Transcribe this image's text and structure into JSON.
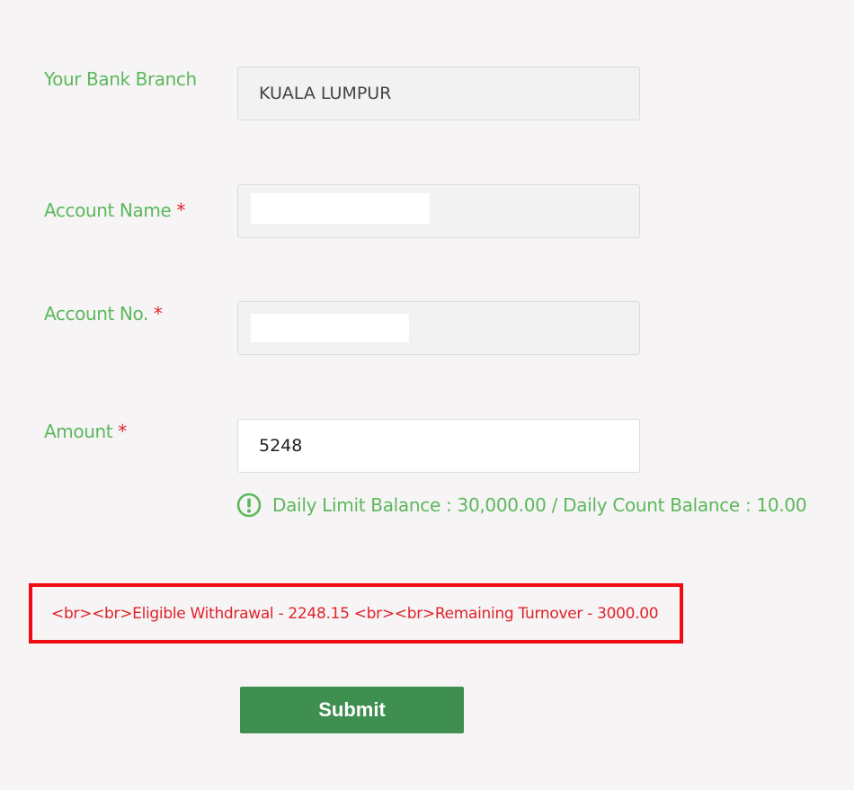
{
  "form": {
    "bank_branch": {
      "label": "Your Bank Branch",
      "value": "KUALA LUMPUR"
    },
    "account_name": {
      "label": "Account Name",
      "required_mark": "*"
    },
    "account_no": {
      "label": "Account No.",
      "required_mark": "*"
    },
    "amount": {
      "label": "Amount",
      "required_mark": "*",
      "value": "5248"
    },
    "limit_hint": "Daily Limit Balance : 30,000.00 / Daily Count Balance : 10.00",
    "notice": "<br><br>Eligible Withdrawal - 2248.15 <br><br>Remaining Turnover - 3000.00",
    "submit_label": "Submit"
  },
  "colors": {
    "label_green": "#5cb85c",
    "required_red": "#e0232a",
    "notice_border": "#ee0b12",
    "button_green": "#3f8f51",
    "background": "#f6f4f5"
  },
  "icons": {
    "hint": "exclamation-circle-icon"
  }
}
